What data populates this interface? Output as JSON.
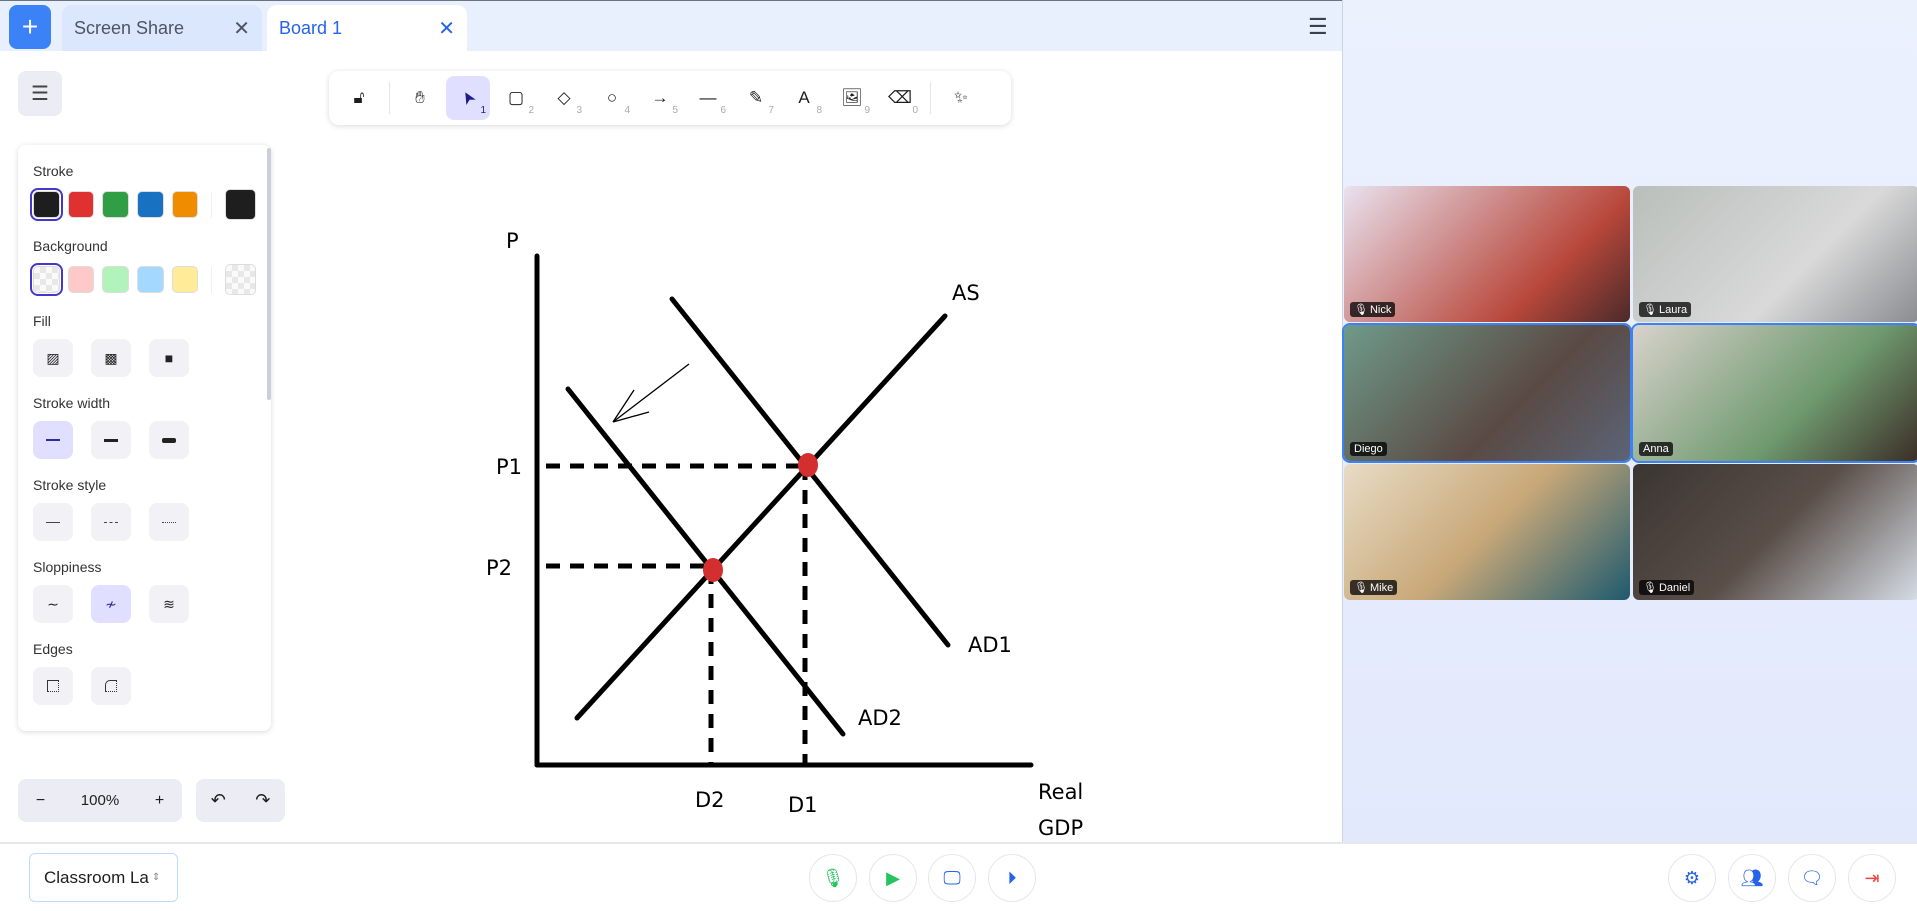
{
  "tabs": [
    {
      "label": "Screen Share",
      "close": "✕"
    },
    {
      "label": "Board 1",
      "close": "✕"
    }
  ],
  "new_tab": "+",
  "toolbar": [
    {
      "icon": "lock-icon",
      "glyph": "🔓︎",
      "key": ""
    },
    {
      "icon": "hand-icon",
      "glyph": "✋︎",
      "key": ""
    },
    {
      "icon": "pointer-icon",
      "glyph": "➤",
      "key": "1"
    },
    {
      "icon": "rectangle-icon",
      "glyph": "▢",
      "key": "2"
    },
    {
      "icon": "diamond-icon",
      "glyph": "◇",
      "key": "3"
    },
    {
      "icon": "circle-icon",
      "glyph": "○",
      "key": "4"
    },
    {
      "icon": "arrow-icon",
      "glyph": "→",
      "key": "5"
    },
    {
      "icon": "line-icon",
      "glyph": "—",
      "key": "6"
    },
    {
      "icon": "pencil-icon",
      "glyph": "✎",
      "key": "7"
    },
    {
      "icon": "text-icon",
      "glyph": "A",
      "key": "8"
    },
    {
      "icon": "image-icon",
      "glyph": "🖼︎",
      "key": "9"
    },
    {
      "icon": "eraser-icon",
      "glyph": "⌫",
      "key": "0"
    },
    {
      "icon": "magic-wand-icon",
      "glyph": "✨︎",
      "key": ""
    }
  ],
  "panel": {
    "stroke_label": "Stroke",
    "stroke_colors": [
      "#1e1e1e",
      "#e03131",
      "#2f9e44",
      "#1971c2",
      "#f08c00"
    ],
    "stroke_current": "#1e1e1e",
    "background_label": "Background",
    "background_colors": [
      "transparent",
      "#ffc9c9",
      "#b2f2bb",
      "#a5d8ff",
      "#ffec99"
    ],
    "fill_label": "Fill",
    "stroke_width_label": "Stroke width",
    "stroke_style_label": "Stroke style",
    "sloppiness_label": "Sloppiness",
    "edges_label": "Edges"
  },
  "zoom": {
    "minus": "−",
    "value": "100%",
    "plus": "+"
  },
  "undo": "↶",
  "redo": "↷",
  "board": {
    "y_label": "P",
    "x_label_1": "Real",
    "x_label_2": "GDP",
    "p1": "P1",
    "p2": "P2",
    "d1": "D1",
    "d2": "D2",
    "as": "AS",
    "ad1": "AD1",
    "ad2": "AD2",
    "equilibrium_color": "#d32f2f"
  },
  "room_select": "Classroom La",
  "participants": [
    {
      "name": "Nick",
      "muted": true,
      "active": false
    },
    {
      "name": "Laura",
      "muted": true,
      "active": false
    },
    {
      "name": "Diego",
      "muted": false,
      "active": true
    },
    {
      "name": "Anna",
      "muted": false,
      "active": true
    },
    {
      "name": "Mike",
      "muted": true,
      "active": false
    },
    {
      "name": "Daniel",
      "muted": true,
      "active": false
    }
  ],
  "mic_glyph": "🎙︎"
}
